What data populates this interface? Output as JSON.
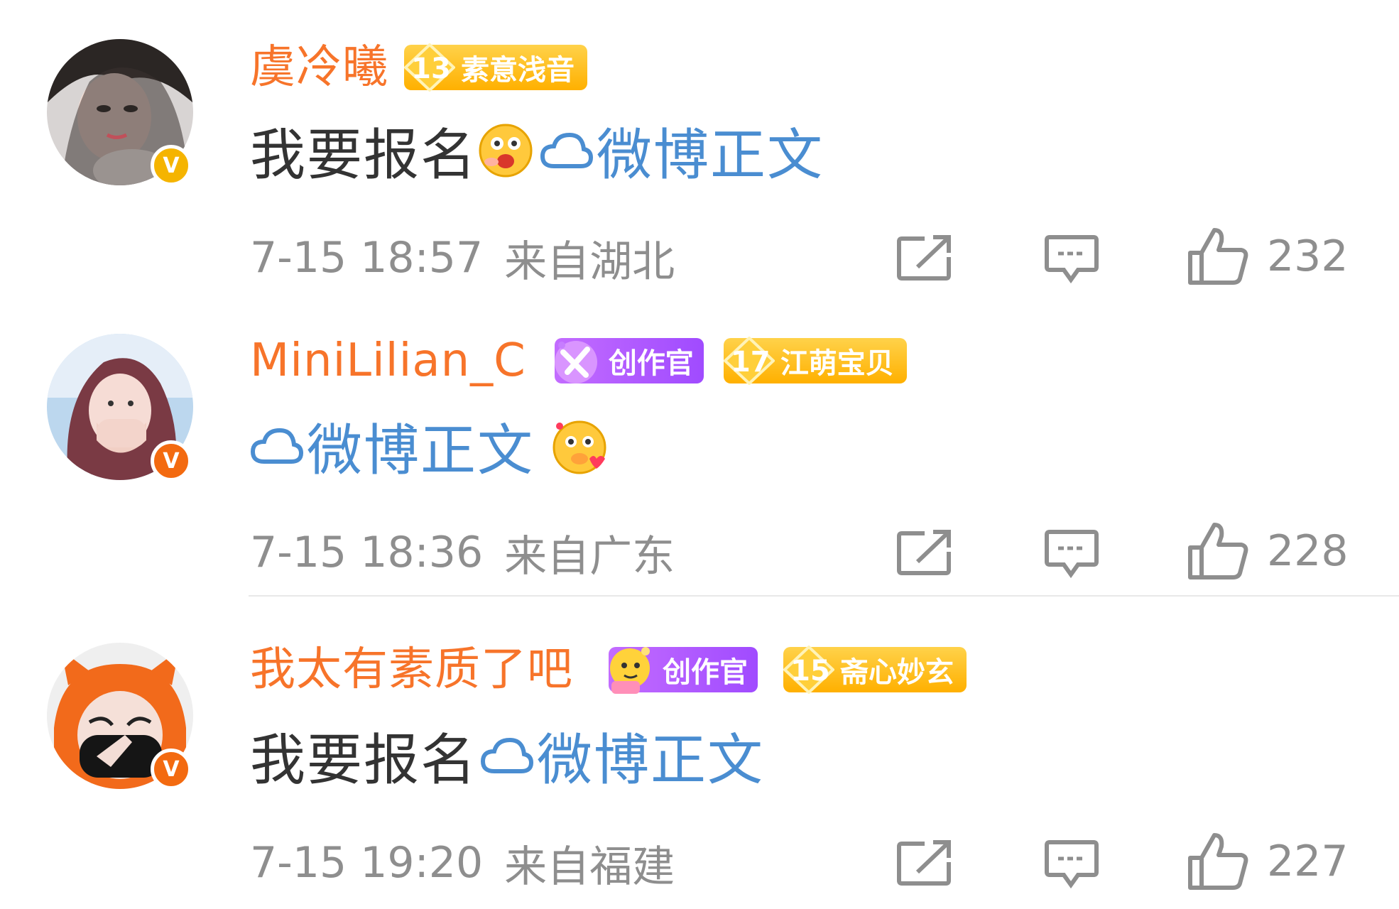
{
  "comments": [
    {
      "username": "虞冷曦",
      "badges": [
        {
          "type": "fan",
          "level": "13",
          "text": "素意浅音"
        }
      ],
      "content": {
        "text": "我要报名",
        "has_emoji_before_link": true,
        "emoji": "surprised-face",
        "link_text": "微博正文"
      },
      "time": "7-15 18:57",
      "location": "来自湖北",
      "likes": "232",
      "verified": "gold"
    },
    {
      "username": "MiniLilian_C",
      "badges": [
        {
          "type": "creator",
          "text": "创作官"
        },
        {
          "type": "fan",
          "level": "17",
          "text": "江萌宝贝"
        }
      ],
      "content": {
        "text": "",
        "link_text": "微博正文",
        "emoji": "love-face"
      },
      "time": "7-15 18:36",
      "location": "来自广东",
      "likes": "228",
      "verified": "orange"
    },
    {
      "username": "我太有素质了吧",
      "badges": [
        {
          "type": "creator",
          "text": "创作官"
        },
        {
          "type": "fan",
          "level": "15",
          "text": "斋心妙玄"
        }
      ],
      "content": {
        "text": "我要报名",
        "link_text": "微博正文"
      },
      "time": "7-15 19:20",
      "location": "来自福建",
      "likes": "227",
      "verified": "orange"
    }
  ],
  "icons": {
    "share": "share-icon",
    "comment": "comment-icon",
    "like": "thumbs-up-icon",
    "link": "weibo-cloud-icon"
  },
  "colors": {
    "username": "#f7742a",
    "link": "#4a8dd1",
    "meta": "#8e8e8e",
    "fan_badge": "#ffc21a",
    "creator_badge": "#b05cff"
  }
}
